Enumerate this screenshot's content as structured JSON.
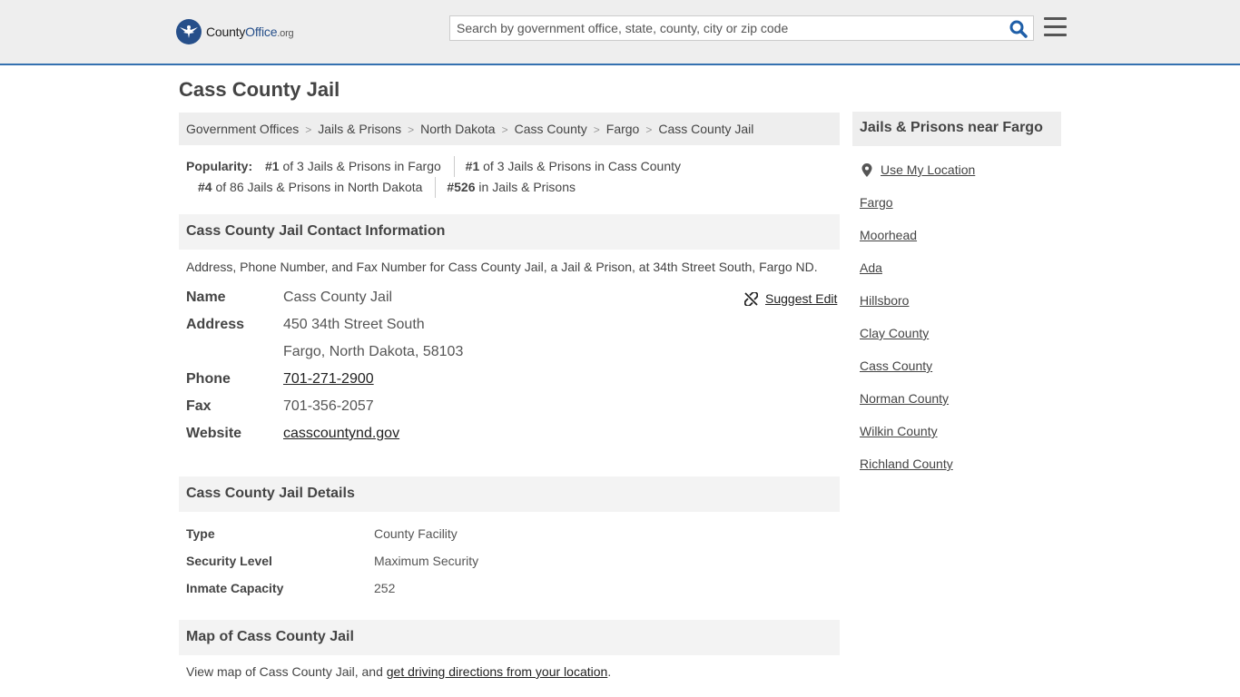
{
  "header": {
    "logo": {
      "prefix": "County",
      "brand": "Office",
      "tld": ".org"
    },
    "search_placeholder": "Search by government office, state, county, city or zip code"
  },
  "page_title": "Cass County Jail",
  "breadcrumb": [
    "Government Offices",
    "Jails & Prisons",
    "North Dakota",
    "Cass County",
    "Fargo",
    "Cass County Jail"
  ],
  "popularity": {
    "label": "Popularity:",
    "items": [
      {
        "rank": "#1",
        "text": " of 3 Jails & Prisons in Fargo"
      },
      {
        "rank": "#1",
        "text": " of 3 Jails & Prisons in Cass County"
      },
      {
        "rank": "#4",
        "text": " of 86 Jails & Prisons in North Dakota"
      },
      {
        "rank": "#526",
        "text": " in Jails & Prisons"
      }
    ]
  },
  "contact": {
    "heading": "Cass County Jail Contact Information",
    "description": "Address, Phone Number, and Fax Number for Cass County Jail, a Jail & Prison, at 34th Street South, Fargo ND.",
    "suggest_edit": "Suggest Edit",
    "name_label": "Name",
    "name": "Cass County Jail",
    "address_label": "Address",
    "address_line1": "450 34th Street South",
    "address_line2": "Fargo, North Dakota, 58103",
    "phone_label": "Phone",
    "phone": "701-271-2900",
    "fax_label": "Fax",
    "fax": "701-356-2057",
    "website_label": "Website",
    "website": "casscountynd.gov"
  },
  "details": {
    "heading": "Cass County Jail Details",
    "rows": [
      {
        "label": "Type",
        "value": "County Facility"
      },
      {
        "label": "Security Level",
        "value": "Maximum Security"
      },
      {
        "label": "Inmate Capacity",
        "value": "252"
      }
    ]
  },
  "map": {
    "heading": "Map of Cass County Jail",
    "text_before": "View map of Cass County Jail, and ",
    "link": "get driving directions from your location",
    "text_after": "."
  },
  "sidebar": {
    "heading": "Jails & Prisons near Fargo",
    "use_location": "Use My Location",
    "links": [
      "Fargo",
      "Moorhead",
      "Ada",
      "Hillsboro",
      "Clay County",
      "Cass County",
      "Norman County",
      "Wilkin County",
      "Richland County"
    ]
  },
  "colors": {
    "brand": "#264f8a",
    "header_border": "#3571b0",
    "search_icon": "#1f5fa8"
  }
}
